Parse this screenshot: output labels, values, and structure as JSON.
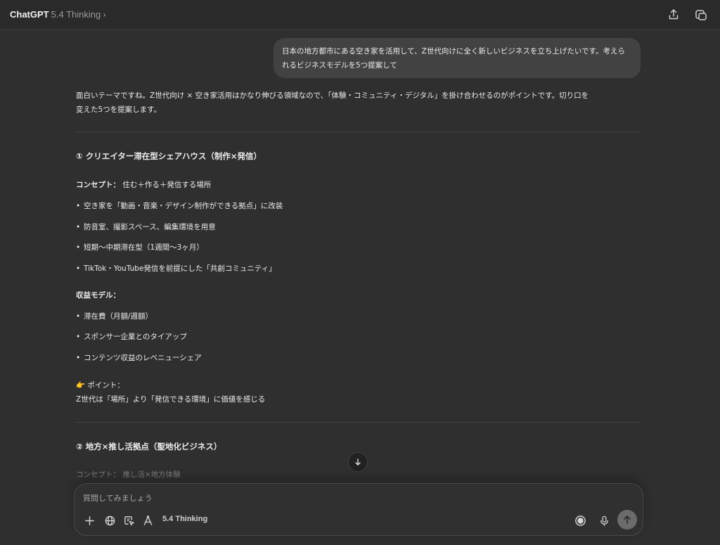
{
  "header": {
    "app_name": "ChatGPT",
    "model_name": "5.4 Thinking",
    "model_chevron": "›",
    "share_icon": "share-icon",
    "new_chat_icon": "new-chat-icon"
  },
  "user_message": "日本の地方都市にある空き家を活用して、Z世代向けに全く新しいビジネスを立ち上げたいです。考えられるビジネスモデルを5つ提案して",
  "response": {
    "intro_line1": "面白いテーマですね。Z世代向け × 空き家活用はかなり伸びる領域なので、「体験・コミュニティ・デジタル」を掛け合わせるのがポイントです。切り口を",
    "intro_line2": "変えた5つを提案します。",
    "section1": {
      "title": "① クリエイター滞在型シェアハウス（制作×発信）",
      "concept_label": "コンセプト：",
      "concept_text": " 住む＋作る＋発信する場所",
      "bullets": [
        "空き家を「動画・音楽・デザイン制作ができる拠点」に改装",
        "防音室、撮影スペース、編集環境を用意",
        "短期〜中期滞在型（1週間〜3ヶ月）",
        "TikTok・YouTube発信を前提にした「共創コミュニティ」"
      ],
      "revenue_label": "収益モデル：",
      "revenue_bullets": [
        "滞在費（月額/週額）",
        "スポンサー企業とのタイアップ",
        "コンテンツ収益のレベニューシェア"
      ],
      "point_emoji": "👉",
      "point_label": " ポイント：",
      "point_text": "Z世代は「場所」より「発信できる環境」に価値を感じる"
    },
    "section2": {
      "title": "② 地方×推し活拠点（聖地化ビジネス）",
      "concept_label": "コンセプト：",
      "concept_text": " 推し活×地方体験"
    },
    "bullet_char": "•"
  },
  "composer": {
    "placeholder": "質問してみましょう",
    "mode_label": "5.4 Thinking",
    "icons": [
      "plus-icon",
      "globe-icon",
      "canvas-icon",
      "tools-icon",
      "voice-mode-icon",
      "microphone-icon",
      "send-arrow-icon"
    ]
  },
  "colors": {
    "background": "#2f2f2f",
    "topbar": "#2a2a2a",
    "user_bubble": "#424242",
    "text": "#ececec",
    "muted": "#9b9b9b"
  }
}
